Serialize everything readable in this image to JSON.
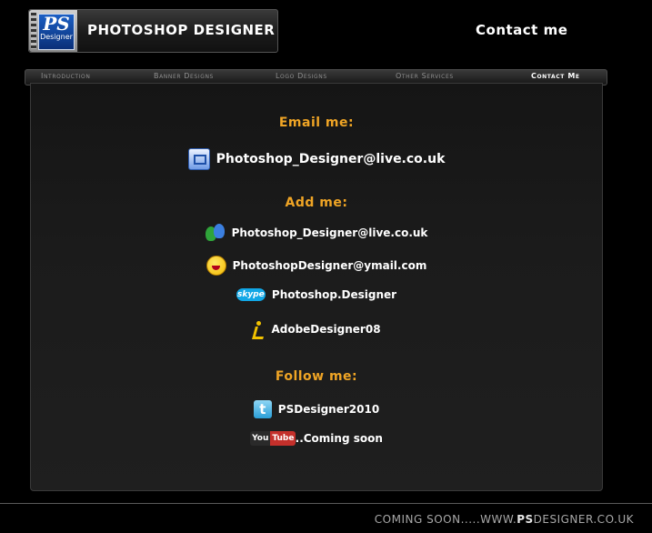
{
  "logo": {
    "badge_text": "PS",
    "badge_subtext": "Designer",
    "title": "PHOTOSHOP DESIGNER"
  },
  "header": {
    "contact_label": "Contact me"
  },
  "nav": {
    "items": [
      {
        "label": "Introduction"
      },
      {
        "label": "Banner Designs"
      },
      {
        "label": "Logo Designs"
      },
      {
        "label": "Other Services"
      },
      {
        "label": "Contact Me"
      }
    ]
  },
  "email": {
    "heading": "Email me:",
    "address": "Photoshop_Designer@live.co.uk"
  },
  "add": {
    "heading": "Add me:",
    "contacts": [
      {
        "icon": "msn-messenger-icon",
        "label": "Photoshop_Designer@live.co.uk"
      },
      {
        "icon": "yahoo-messenger-icon",
        "label": "PhotoshopDesigner@ymail.com"
      },
      {
        "icon": "skype-icon",
        "icon_text": "skype",
        "label": "Photoshop.Designer"
      },
      {
        "icon": "aim-icon",
        "label": "AdobeDesigner08"
      }
    ]
  },
  "follow": {
    "heading": "Follow me:",
    "twitter": {
      "icon": "twitter-icon",
      "icon_text": "t",
      "label": "PSDesigner2010"
    },
    "youtube": {
      "icon": "youtube-icon",
      "icon_text_1": "You",
      "icon_text_2": "Tube",
      "label": "...Coming soon"
    }
  },
  "footer": {
    "prefix": "COMING SOON.....WWW.",
    "brand": "PS",
    "suffix": "DESIGNER.CO.UK"
  },
  "colors": {
    "accent": "#f0a525",
    "background": "#000000"
  }
}
